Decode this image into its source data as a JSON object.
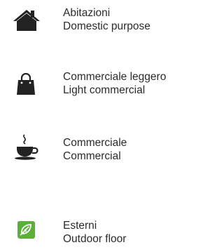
{
  "items": [
    {
      "icon": "house-icon",
      "label_it": "Abitazioni",
      "label_en": "Domestic purpose"
    },
    {
      "icon": "shopping-bag-icon",
      "label_it": "Commerciale leggero",
      "label_en": "Light commercial"
    },
    {
      "icon": "coffee-cup-icon",
      "label_it": "Commerciale",
      "label_en": "Commercial"
    },
    {
      "icon": "leaf-icon",
      "label_it": "Esterni",
      "label_en": "Outdoor floor",
      "icon_color": "#5bb03a"
    }
  ]
}
